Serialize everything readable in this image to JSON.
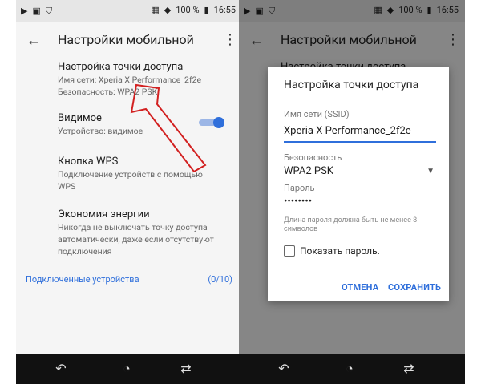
{
  "status": {
    "battery": "100 %",
    "time": "16:55"
  },
  "left": {
    "toolbar_title": "Настройки мобильной",
    "items": [
      {
        "title": "Настройка точки доступа",
        "sub1": "Имя сети: Xperia X Performance_2f2e",
        "sub2": "Безопасность: WPA2 PSK"
      },
      {
        "title": "Видимое",
        "sub1": "Устройство: видимое"
      },
      {
        "title": "Кнопка WPS",
        "sub1": "Подключение устройств с помощью",
        "sub2": "WPS"
      },
      {
        "title": "Экономия энергии",
        "sub1": "Никогда не выключать точку доступа",
        "sub2": "автоматически, даже если отсутствуют",
        "sub3": "подключения"
      }
    ],
    "connected_label": "Подключенные устройства",
    "connected_count": "(0/10)"
  },
  "right": {
    "toolbar_title": "Настройки мобильной",
    "bg_item_title": "Настройка точки доступа",
    "dialog": {
      "title": "Настройка точки доступа",
      "ssid_label": "Имя сети (SSID)",
      "ssid_value": "Xperia X Performance_2f2e",
      "security_label": "Безопасность",
      "security_value": "WPA2 PSK",
      "password_label": "Пароль",
      "password_value": "••••••••",
      "helper_line1": "Длина пароля должна быть не менее 8",
      "helper_line2": "символов",
      "show_password_label": "Показать пароль.",
      "cancel": "ОТМЕНА",
      "save": "СОХРАНИТЬ"
    }
  },
  "colors": {
    "accent": "#2f6fdb",
    "arrow": "#d22020"
  }
}
